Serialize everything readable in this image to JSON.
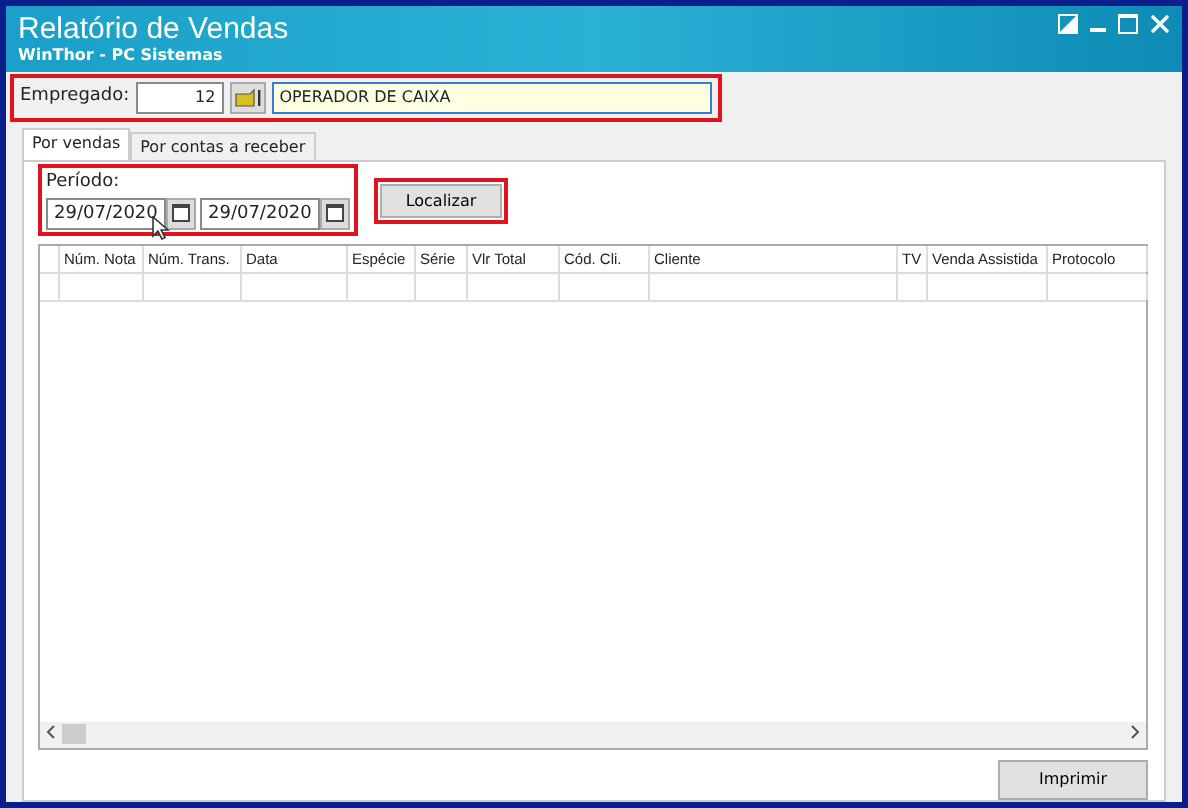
{
  "window": {
    "title": "Relatório de Vendas",
    "subtitle": "WinThor - PC Sistemas"
  },
  "employee": {
    "label": "Empregado:",
    "code": "12",
    "name": "OPERADOR DE CAIXA",
    "highlighted": true
  },
  "tabs": [
    {
      "label": "Por vendas",
      "selected": true
    },
    {
      "label": "Por contas a receber",
      "selected": false
    }
  ],
  "period": {
    "label": "Período:",
    "start": "29/07/2020",
    "end": "29/07/2020",
    "highlighted": true
  },
  "search_button": {
    "label": "Localizar",
    "highlighted": true
  },
  "table": {
    "columns": [
      "Núm. Nota",
      "Núm. Trans.",
      "Data",
      "Espécie",
      "Série",
      "Vlr Total",
      "Cód. Cli.",
      "Cliente",
      "TV",
      "Venda Assistida",
      "Protocolo"
    ]
  },
  "print_button": {
    "label": "Imprimir"
  }
}
